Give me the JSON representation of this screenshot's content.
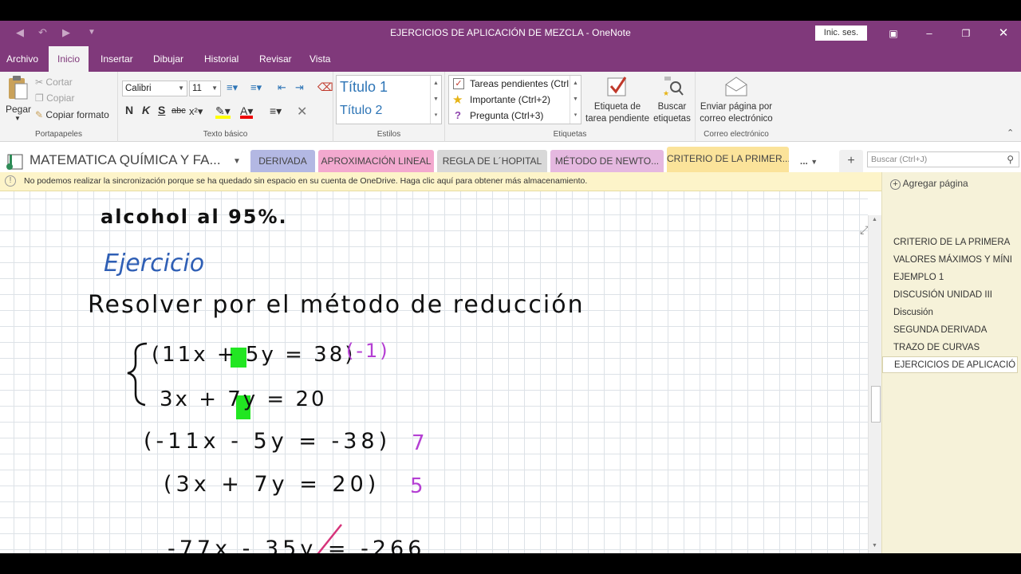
{
  "window": {
    "title": "EJERCICIOS DE APLICACIÓN DE MEZCLA  -  OneNote",
    "signin": "Inic. ses."
  },
  "menu": {
    "tabs": [
      "Archivo",
      "Inicio",
      "Insertar",
      "Dibujar",
      "Historial",
      "Revisar",
      "Vista"
    ],
    "active": "Inicio"
  },
  "ribbon": {
    "clipboard": {
      "paste": "Pegar",
      "cut": "Cortar",
      "copy": "Copiar",
      "format_painter": "Copiar formato",
      "label": "Portapapeles"
    },
    "basic_text": {
      "font": "Calibri",
      "size": "11",
      "bold": "N",
      "italic": "K",
      "strike": "S",
      "label": "Texto básico"
    },
    "styles": {
      "heading1": "Título 1",
      "heading2": "Título 2",
      "label": "Estilos"
    },
    "tags": {
      "items": [
        "Tareas pendientes (Ctrl",
        "Importante (Ctrl+2)",
        "Pregunta (Ctrl+3)"
      ],
      "todo_button_line1": "Etiqueta de",
      "todo_button_line2": "tarea pendiente",
      "find_button_line1": "Buscar",
      "find_button_line2": "etiquetas",
      "label": "Etiquetas"
    },
    "email": {
      "line1": "Enviar página por",
      "line2": "correo electrónico",
      "label": "Correo electrónico"
    }
  },
  "notebook": {
    "title": "MATEMATICA QUÍMICA Y FA...",
    "sections": [
      {
        "label": "DERIVADA",
        "color": "#b3b8e3"
      },
      {
        "label": "APROXIMACIÓN LINEAL",
        "color": "#f3a9cf"
      },
      {
        "label": "REGLA DE L´HOPITAL",
        "color": "#d8d8d8"
      },
      {
        "label": "MÉTODO DE NEWTO...",
        "color": "#e5b8e0"
      },
      {
        "label": "CRITERIO DE LA PRIMER...",
        "color": "#fbe39a"
      }
    ],
    "more": "...",
    "search_placeholder": "Buscar (Ctrl+J)"
  },
  "banner": {
    "text": "No podemos realizar la sincronización porque se ha quedado sin espacio en su cuenta de OneDrive. Haga clic aquí para obtener más almacenamiento."
  },
  "pages": {
    "add_label": "Agregar página",
    "items": [
      "CRITERIO DE LA PRIMERA",
      "VALORES MÁXIMOS Y MÍNI",
      "EJEMPLO 1",
      "DISCUSIÓN UNIDAD III",
      "Discusión",
      "SEGUNDA DERIVADA",
      "TRAZO DE CURVAS",
      "EJERCICIOS DE APLICACIÓ"
    ],
    "selected_index": 7
  },
  "ink": {
    "top_fragment": "alcohol al 95%.",
    "heading": "Ejercicio",
    "instruction": "Resolver por el método de reducción",
    "eq1": "(11x + 5y = 38)",
    "eq1_mult": "(-1)",
    "eq2": "3x + 7y = 20",
    "eq3": "(-11x - 5y = -38)",
    "eq3_mult": "7",
    "eq4": "(3x + 7y = 20)",
    "eq4_mult": "5",
    "eq5": "-77x - 35y = -266",
    "colors": {
      "ink": "#111111",
      "blue": "#2f5fb5",
      "purple": "#b43fd3",
      "highlight": "#22e622",
      "strike": "#d6337a"
    }
  }
}
